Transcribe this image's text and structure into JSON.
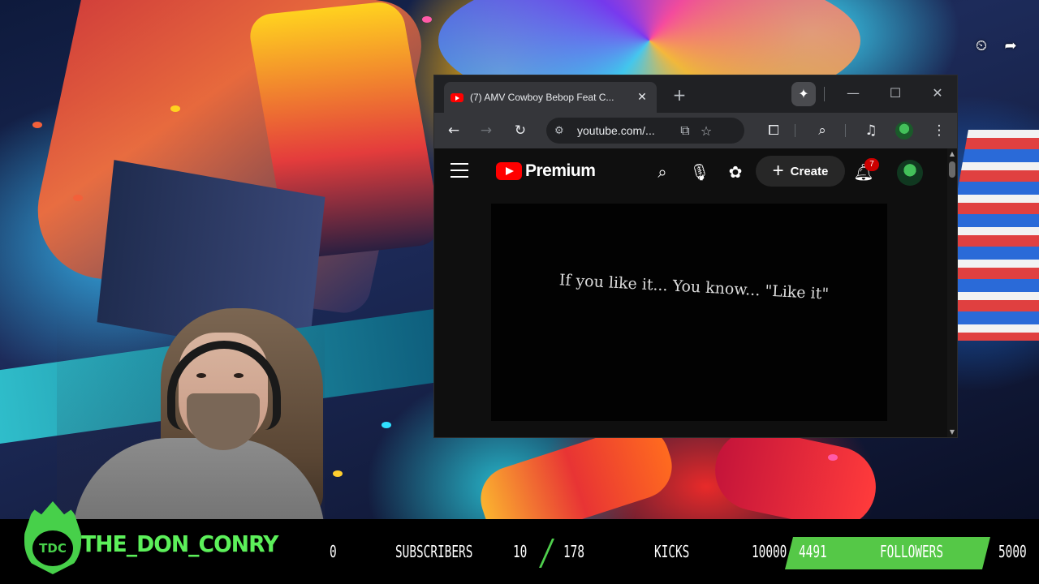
{
  "overlay_icons": {
    "clock": "clock-icon",
    "share": "share-icon"
  },
  "browser": {
    "tab": {
      "title": "(7) AMV Cowboy Bebop Feat C...",
      "close": "✕"
    },
    "new_tab": "+",
    "window_controls": {
      "minimize": "—",
      "maximize": "☐",
      "close": "✕"
    },
    "address_bar": {
      "url": "youtube.com/..."
    }
  },
  "youtube": {
    "logo_text": "Premium",
    "create_label": "Create",
    "notification_count": "7",
    "video_caption": "If you like it... You know... \"Like it\""
  },
  "stream_overlay": {
    "logo_text": "TDC",
    "channel_name": "THE_DON_CONRY",
    "subscribers": {
      "current": "0",
      "label": "SUBSCRIBERS"
    },
    "kicks": {
      "current": "10",
      "goal": "178",
      "label": "KICKS"
    },
    "followers": {
      "min": "10000",
      "current": "4491",
      "label": "FOLLOWERS",
      "max": "5000",
      "progress": 0.9
    },
    "colors": {
      "accent_green": "#5cf05a",
      "bar_green": "#55c847"
    }
  }
}
